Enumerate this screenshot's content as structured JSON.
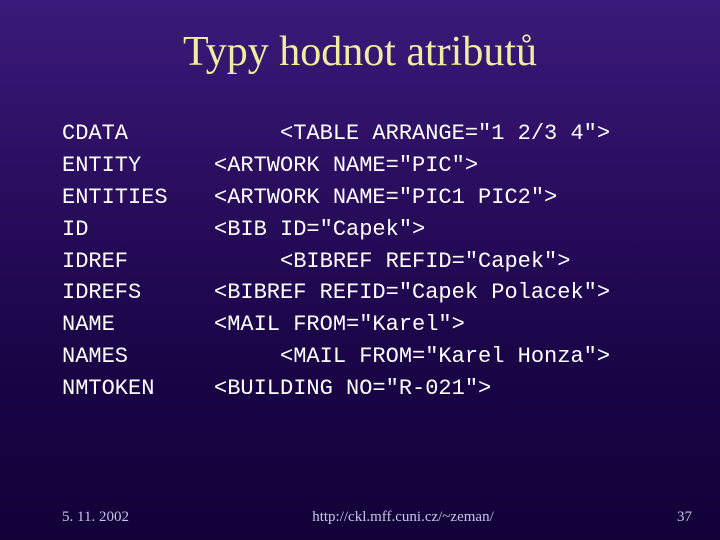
{
  "title": "Typy hodnot atributů",
  "rows": [
    {
      "term": "CDATA",
      "example": "     <TABLE ARRANGE=\"1 2/3 4\">"
    },
    {
      "term": "ENTITY",
      "example": "<ARTWORK NAME=\"PIC\">"
    },
    {
      "term": "ENTITIES",
      "example": "<ARTWORK NAME=\"PIC1 PIC2\">"
    },
    {
      "term": "ID",
      "example": "<BIB ID=\"Capek\">"
    },
    {
      "term": "IDREF",
      "example": "     <BIBREF REFID=\"Capek\">"
    },
    {
      "term": "IDREFS",
      "example": "<BIBREF REFID=\"Capek Polacek\">"
    },
    {
      "term": "NAME",
      "example": "<MAIL FROM=\"Karel\">"
    },
    {
      "term": "NAMES",
      "example": "     <MAIL FROM=\"Karel Honza\">"
    },
    {
      "term": "NMTOKEN",
      "example": "<BUILDING NO=\"R-021\">"
    }
  ],
  "footer": {
    "date": "5. 11. 2002",
    "url": "http://ckl.mff.cuni.cz/~zeman/",
    "slide_number": "37"
  }
}
